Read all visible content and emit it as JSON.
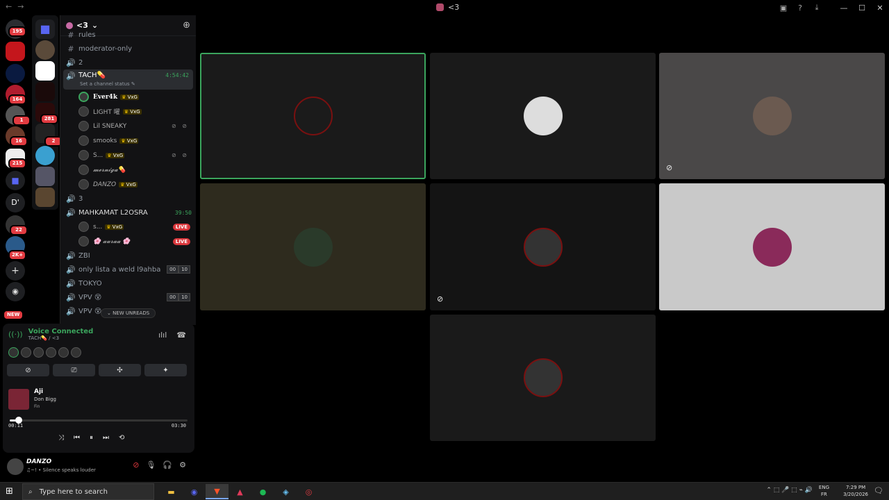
{
  "window": {
    "title": "<3",
    "nav_back": "←",
    "nav_fwd": "→",
    "minimize": "—",
    "maximize": "☐",
    "close": "✕"
  },
  "servers": {
    "badges": [
      "195",
      "164",
      "1",
      "16",
      "215",
      "22",
      "2K+",
      "281",
      "2"
    ],
    "dm_letter": "D'",
    "new_label": "NEW",
    "add_label": "+",
    "discover_label": "◉"
  },
  "sidebar": {
    "server_name": "<3",
    "channels_top": [
      {
        "icon": "#",
        "name": "rules"
      },
      {
        "icon": "#",
        "name": "moderator-only"
      },
      {
        "icon": "🔊",
        "name": "2"
      }
    ],
    "active_channel": {
      "name": "TACH💊",
      "status": "Set a channel status ✎",
      "timer": "4:54:42"
    },
    "tach_users": [
      {
        "name": "Ever4k",
        "tag": "VxG",
        "style": "bold",
        "flags": ""
      },
      {
        "name": "LIGHT 曜",
        "tag": "VxG",
        "style": "",
        "flags": ""
      },
      {
        "name": "Lil SNEAKY",
        "tag": "",
        "style": "",
        "flags": "⊘ ⊘"
      },
      {
        "name": "smooks",
        "tag": "VxG",
        "style": "",
        "flags": ""
      },
      {
        "name": "S...",
        "tag": "VxG",
        "style": "",
        "flags": "⊘ ⊘"
      },
      {
        "name": "𝓶𝓮𝓻𝓷𝓲𝓰𝓪💊",
        "tag": "",
        "style": "italic",
        "flags": ""
      },
      {
        "name": "DANZO",
        "tag": "VxG",
        "style": "italic",
        "flags": ""
      }
    ],
    "channel_3": "3",
    "channel_mahk": {
      "name": "MAHKAMAT L2OSRA",
      "timer": "39:50"
    },
    "mahk_users": [
      {
        "name": "s...",
        "tag": "VxG",
        "live": "LIVE"
      },
      {
        "name": "🌸 𝓪𝓾𝓻𝓪𝓪 🌸",
        "tag": "",
        "live": "LIVE"
      }
    ],
    "channels_bottom": [
      {
        "name": "ZBI",
        "c1": "",
        "c2": ""
      },
      {
        "name": "only lista a weld l9ahba",
        "c1": "00",
        "c2": "10"
      },
      {
        "name": "TOKYO",
        "c1": "",
        "c2": ""
      },
      {
        "name": "VPV 😵",
        "c1": "00",
        "c2": "10"
      },
      {
        "name": "VPV 😵",
        "c1": "",
        "c2": ""
      }
    ],
    "new_unreads": "⌄ NEW UNREADS"
  },
  "voice": {
    "status": "Voice Connected",
    "location": "TACH💊 / <3",
    "signal_icon": "((·))",
    "soundboard_icon": "ılıl",
    "disconnect_icon": "☎",
    "btn_camera": "⊘",
    "btn_screen": "⎚",
    "btn_activity": "✣",
    "btn_effects": "✦"
  },
  "music": {
    "song": "Aji",
    "artist": "Don Bigg",
    "album": "Fin",
    "current_time": "00:11",
    "total_time": "03:30",
    "progress": 0.052,
    "shuffle": "⤨",
    "prev": "⏮",
    "pause": "⏸",
    "next": "⏭",
    "repeat": "⟲"
  },
  "user": {
    "name": "DANZO",
    "status": "♫~! • Silence speaks louder",
    "deafen_icon": "⊘",
    "mic_icon": "🎙",
    "headset_icon": "🎧",
    "settings_icon": "⚙"
  },
  "taskbar": {
    "search_placeholder": "Type here to search",
    "start_icon": "⊞",
    "search_icon": "⌕",
    "lang_top": "ENG",
    "lang_bottom": "FR",
    "time": "7:29 PM",
    "date": "3/20/2026",
    "tray_icons": "⌃ ⬚ 🎤 ⬚ ⌁ 🔊",
    "notif": "🗨"
  },
  "colors": {
    "accent_green": "#3ba55d",
    "live_red": "#da373c",
    "badge_red": "#e23b41"
  }
}
